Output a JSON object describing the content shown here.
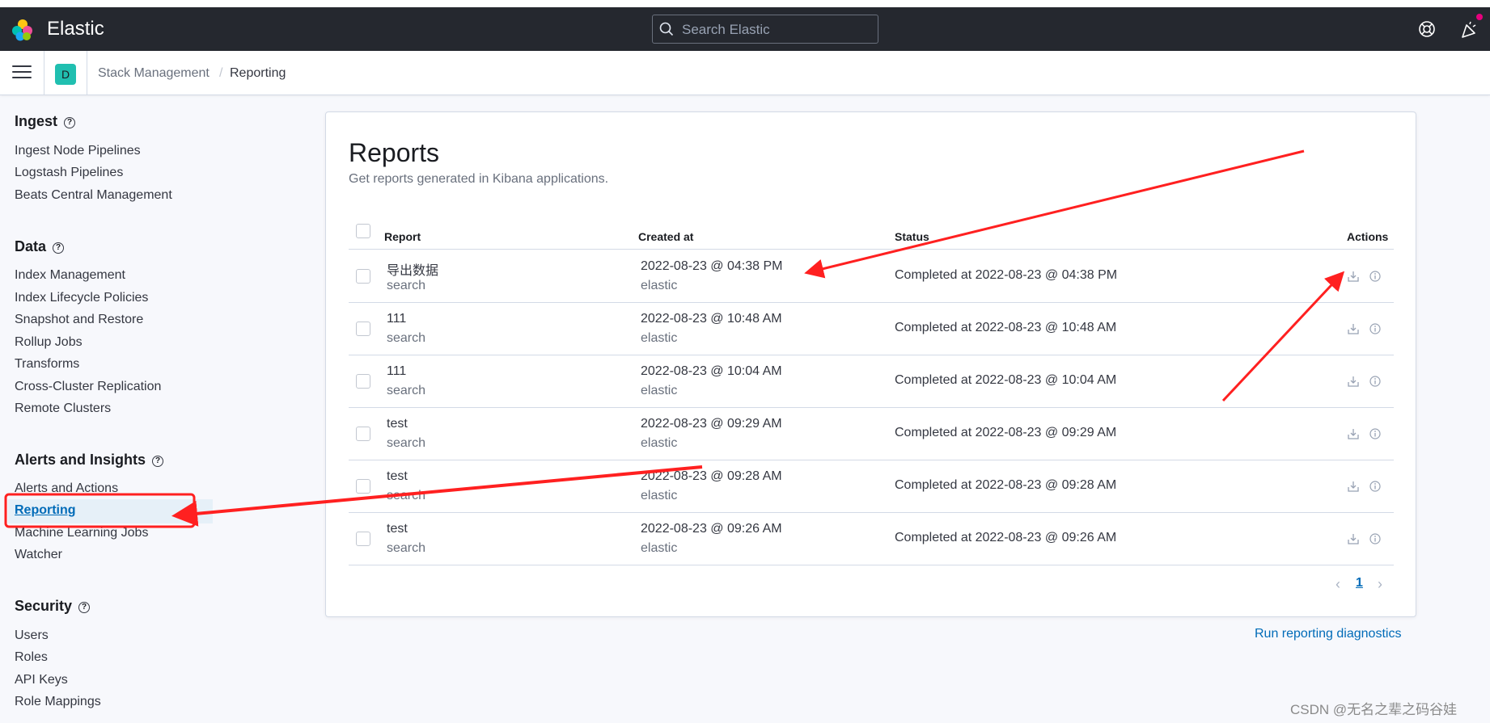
{
  "header": {
    "brand": "Elastic",
    "search_placeholder": "Search Elastic"
  },
  "subheader": {
    "space_initial": "D",
    "breadcrumbs": [
      "Stack Management",
      "Reporting"
    ]
  },
  "sidebar": {
    "sections": [
      {
        "title": "Ingest",
        "items": [
          "Ingest Node Pipelines",
          "Logstash Pipelines",
          "Beats Central Management"
        ]
      },
      {
        "title": "Data",
        "items": [
          "Index Management",
          "Index Lifecycle Policies",
          "Snapshot and Restore",
          "Rollup Jobs",
          "Transforms",
          "Cross-Cluster Replication",
          "Remote Clusters"
        ]
      },
      {
        "title": "Alerts and Insights",
        "items": [
          "Alerts and Actions",
          "Reporting",
          "Machine Learning Jobs",
          "Watcher"
        ]
      },
      {
        "title": "Security",
        "items": [
          "Users",
          "Roles",
          "API Keys",
          "Role Mappings"
        ]
      }
    ],
    "active_item": "Reporting"
  },
  "reports": {
    "title": "Reports",
    "description": "Get reports generated in Kibana applications.",
    "columns": [
      "Report",
      "Created at",
      "Status",
      "Actions"
    ],
    "rows": [
      {
        "name": "导出数据",
        "type": "search",
        "created": "2022-08-23 @ 04:38 PM",
        "user": "elastic",
        "status": "Completed at 2022-08-23 @ 04:38 PM"
      },
      {
        "name": "111",
        "type": "search",
        "created": "2022-08-23 @ 10:48 AM",
        "user": "elastic",
        "status": "Completed at 2022-08-23 @ 10:48 AM"
      },
      {
        "name": "111",
        "type": "search",
        "created": "2022-08-23 @ 10:04 AM",
        "user": "elastic",
        "status": "Completed at 2022-08-23 @ 10:04 AM"
      },
      {
        "name": "test",
        "type": "search",
        "created": "2022-08-23 @ 09:29 AM",
        "user": "elastic",
        "status": "Completed at 2022-08-23 @ 09:29 AM"
      },
      {
        "name": "test",
        "type": "search",
        "created": "2022-08-23 @ 09:28 AM",
        "user": "elastic",
        "status": "Completed at 2022-08-23 @ 09:28 AM"
      },
      {
        "name": "test",
        "type": "search",
        "created": "2022-08-23 @ 09:26 AM",
        "user": "elastic",
        "status": "Completed at 2022-08-23 @ 09:26 AM"
      }
    ],
    "current_page": "1",
    "diagnostics_link": "Run reporting diagnostics"
  },
  "watermark": "CSDN @无名之辈之码谷娃",
  "icons": {
    "logo": "elastic-logo-icon",
    "search": "search-icon",
    "help": "help-icon",
    "news": "newsfeed-icon",
    "menu": "hamburger-menu-icon",
    "download": "download-icon",
    "info": "info-icon"
  },
  "colors": {
    "header_bg": "#25282f",
    "link": "#006bb8",
    "space_avatar": "#20bfb0",
    "annotation": "#ff2020"
  }
}
